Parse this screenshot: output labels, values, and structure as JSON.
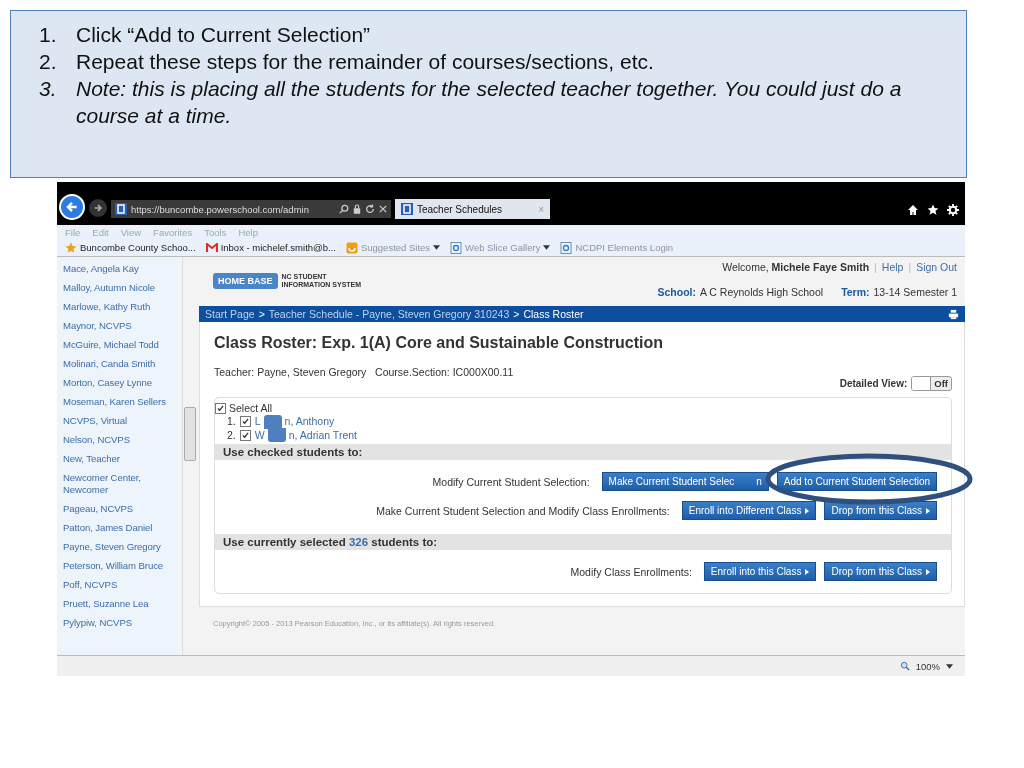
{
  "slide_notes": [
    {
      "marker": "1.",
      "text": "Click “Add to Current Selection”",
      "italic": false
    },
    {
      "marker": "2.",
      "text": "Repeat these steps for the remainder of courses/sections, etc.",
      "italic": false
    },
    {
      "marker": "3.",
      "text": "Note:  this is placing all the students for the selected teacher together.  You could just do a course at a time.",
      "italic": true
    }
  ],
  "browser": {
    "address": "https://buncombe.powerschool.com/admin",
    "tab_title": "Teacher Schedules",
    "tab_close": "×",
    "menu": [
      "File",
      "Edit",
      "View",
      "Favorites",
      "Tools",
      "Help"
    ],
    "favorites": [
      {
        "label": "Buncombe County Schoo...",
        "kind": "school",
        "dropdown": false
      },
      {
        "label": "Inbox - michelef.smith@b...",
        "kind": "mail",
        "dropdown": false
      },
      {
        "label": "Suggested Sites",
        "kind": "suggested",
        "dropdown": true
      },
      {
        "label": "Web Slice Gallery",
        "kind": "ie",
        "dropdown": true
      },
      {
        "label": "NCDPI Elements Login",
        "kind": "ie",
        "dropdown": false
      }
    ],
    "zoom": "100%"
  },
  "sidebar": {
    "items": [
      "Mace, Angela Kay",
      "Malloy, Autumn Nicole",
      "Marlowe, Kathy Ruth",
      "Maynor, NCVPS",
      "McGuire, Michael Todd",
      "Molinari, Canda Smith",
      "Morton, Casey Lynne",
      "Moseman, Karen Sellers",
      "NCVPS, Virtual",
      "Nelson, NCVPS",
      "New, Teacher",
      "Newcomer Center, Newcomer",
      "Pageau, NCVPS",
      "Patton, James Daniel",
      "Payne, Steven Gregory",
      "Peterson, William Bruce",
      "Poff, NCVPS",
      "Pruett, Suzanne Lea",
      "Pylypiw, NCVPS"
    ]
  },
  "header": {
    "logo": "HOME BASE",
    "logo_sub": [
      "NC STUDENT",
      "INFORMATION SYSTEM"
    ],
    "welcome": "Welcome,",
    "user": "Michele Faye Smith",
    "links": [
      "Help",
      "Sign Out"
    ],
    "link_separator": "|",
    "school_label": "School:",
    "school": "A C Reynolds High School",
    "term_label": "Term:",
    "term": "13-14 Semester 1"
  },
  "breadcrumb": {
    "links": [
      "Start Page",
      "Teacher Schedule - Payne, Steven Gregory 310243"
    ],
    "separator": ">",
    "current": "Class Roster"
  },
  "roster": {
    "title": "Class Roster: Exp. 1(A) Core and Sustainable Construction",
    "teacher_line": "Teacher: Payne, Steven Gregory   Course.Section: IC000X00.11",
    "detailed_view": {
      "label": "Detailed View:",
      "toggle": "Off",
      "on": false
    },
    "select_all": {
      "label": "Select All",
      "checked": true
    },
    "students": [
      {
        "number": "1.",
        "checked": true,
        "name_start": "L",
        "name_end": "n, Anthony"
      },
      {
        "number": "2.",
        "checked": true,
        "name_start": "W",
        "name_end": "n, Adrian Trent"
      }
    ],
    "sections": [
      {
        "heading": "Use checked students to:",
        "rows": [
          {
            "label": "Modify Current Student Selection:",
            "buttons": [
              {
                "label": "Make Current Student Selec",
                "label_end": "n",
                "arrow": false
              },
              {
                "label": "Add to Current Student Selection",
                "arrow": false
              }
            ]
          },
          {
            "label": "Make Current Student Selection and Modify Class Enrollments:",
            "buttons": [
              {
                "label": "Enroll into Different Class",
                "arrow": true
              },
              {
                "label": "Drop from this Class",
                "arrow": true
              }
            ]
          }
        ]
      },
      {
        "heading": "Use currently selected",
        "count": "326",
        "heading_end": "students to:",
        "rows": [
          {
            "label": "Modify Class Enrollments:",
            "buttons": [
              {
                "label": "Enroll into this Class",
                "arrow": true
              },
              {
                "label": "Drop from this Class",
                "arrow": true
              }
            ]
          }
        ]
      }
    ]
  },
  "footer": "Copyright© 2005 - 2013 Pearson Education, Inc., or its affiliate(s). All rights reserved."
}
